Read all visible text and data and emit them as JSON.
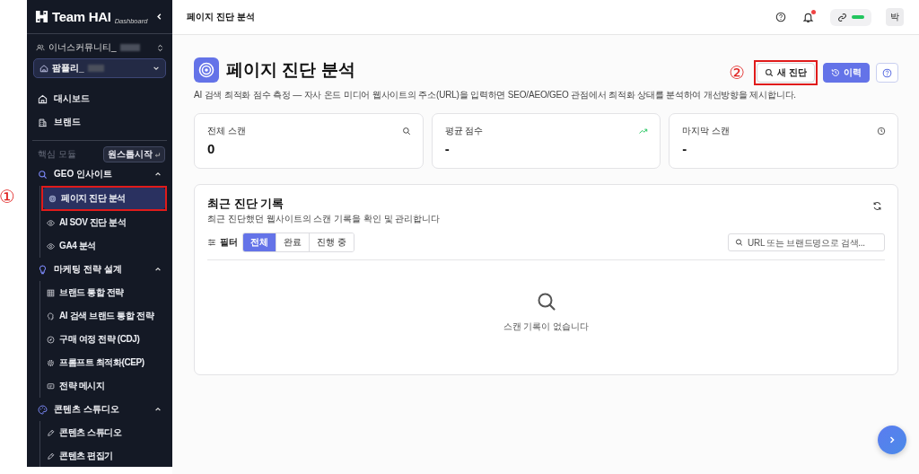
{
  "sidebar": {
    "logo": "Team HAI",
    "logo_sub": "Dashboard",
    "org": "이너스커뮤니티_",
    "project": "팜플리_",
    "nav": [
      {
        "label": "대시보드"
      },
      {
        "label": "브랜드"
      }
    ],
    "section_label": "핵심 모듈",
    "section_badge": "원스톱시작",
    "groups": [
      {
        "label": "GEO 인사이트",
        "expanded": true,
        "children": [
          {
            "label": "페이지 진단 분석",
            "selected": true,
            "annotation": "①"
          },
          {
            "label": "AI SOV 진단 분석",
            "selected": false
          },
          {
            "label": "GA4 분석",
            "selected": false
          }
        ]
      },
      {
        "label": "마케팅 전략 설계",
        "expanded": true,
        "children": [
          {
            "label": "브랜드 통합 전략",
            "selected": false
          },
          {
            "label": "AI 검색 브랜드 통합 전략",
            "selected": false
          },
          {
            "label": "구매 여정 전략 (CDJ)",
            "selected": false
          },
          {
            "label": "프롬프트 최적화(CEP)",
            "selected": false
          },
          {
            "label": "전략 메시지",
            "selected": false
          }
        ]
      },
      {
        "label": "콘텐츠 스튜디오",
        "expanded": true,
        "children": [
          {
            "label": "콘텐츠 스튜디오",
            "selected": false
          },
          {
            "label": "콘텐츠 편집기",
            "selected": false
          }
        ]
      }
    ]
  },
  "header": {
    "title": "페이지 진단 분석",
    "has_unread": true,
    "connected": true,
    "avatar": "박"
  },
  "page": {
    "title": "페이지 진단 분석",
    "description": "AI 검색 최적화 점수 측정 — 자사 온드 미디어 웹사이트의 주소(URL)을 입력하면 SEO/AEO/GEO 관점에서 최적화 상태를 분석하여 개선방향을 제시합니다.",
    "buttons": [
      {
        "kind": "outline",
        "label": "새 진단",
        "annotation": "②"
      },
      {
        "kind": "primary",
        "label": "이력"
      },
      {
        "kind": "help"
      }
    ]
  },
  "stats": [
    {
      "label": "전체 스캔",
      "value": "0"
    },
    {
      "label": "평균 점수",
      "value": "-"
    },
    {
      "label": "마지막 스캔",
      "value": "-"
    }
  ],
  "records": {
    "title": "최근 진단 기록",
    "subtitle": "최근 진단했던 웹사이트의 스캔 기록을 확인 및 관리합니다",
    "filter_label": "필터",
    "filters": [
      {
        "label": "전체",
        "selected": true
      },
      {
        "label": "완료",
        "selected": false
      },
      {
        "label": "진행 중",
        "selected": false
      }
    ],
    "search": {
      "placeholder": "URL 또는 브랜드명으로 검색..."
    },
    "empty_text": "스캔 기록이 없습니다"
  }
}
